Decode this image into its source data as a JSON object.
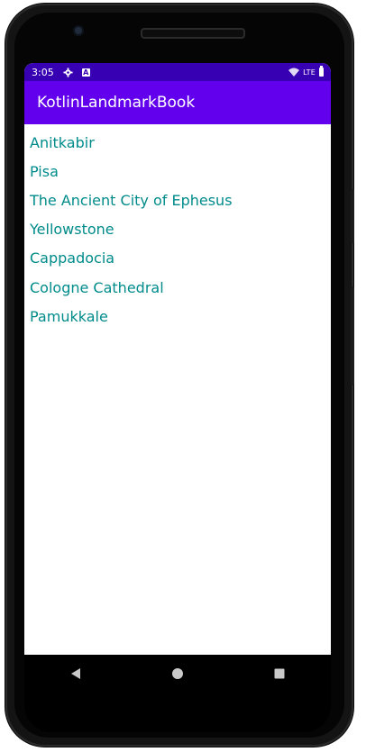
{
  "status_bar": {
    "time": "3:05",
    "network": "LTE"
  },
  "app_bar": {
    "title": "KotlinLandmarkBook"
  },
  "landmarks": [
    "Anitkabir",
    "Pisa",
    "The Ancient City of Ephesus",
    "Yellowstone",
    "Cappadocia",
    "Cologne Cathedral",
    "Pamukkale"
  ],
  "navigation": {
    "back_icon": "back-triangle-icon",
    "home_icon": "home-circle-icon",
    "recents_icon": "recents-square-icon"
  },
  "colors": {
    "status_bar": "#3700b3",
    "app_bar": "#6200ee",
    "list_text": "#008b8b"
  }
}
